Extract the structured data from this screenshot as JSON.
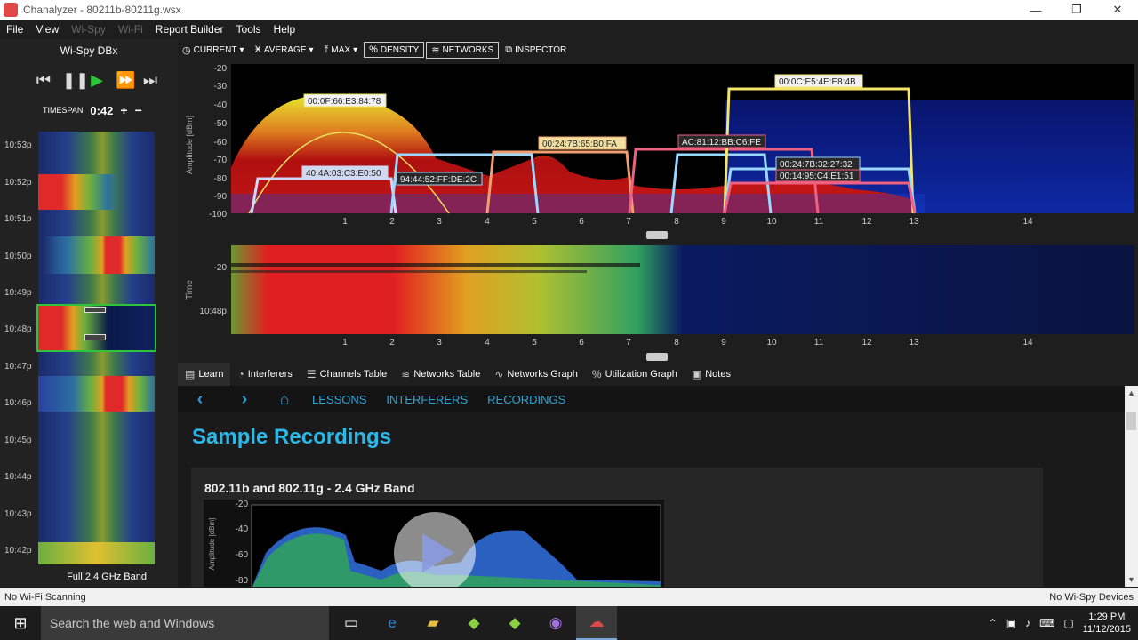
{
  "window": {
    "title": "Chanalyzer - 80211b-80211g.wsx",
    "minimize": "—",
    "restore": "❐",
    "close": "✕"
  },
  "menu": {
    "items": [
      {
        "label": "File",
        "dim": false
      },
      {
        "label": "View",
        "dim": false
      },
      {
        "label": "Wi-Spy",
        "dim": true
      },
      {
        "label": "Wi-Fi",
        "dim": true
      },
      {
        "label": "Report Builder",
        "dim": false
      },
      {
        "label": "Tools",
        "dim": false
      },
      {
        "label": "Help",
        "dim": false
      }
    ]
  },
  "left": {
    "device": "Wi-Spy DBx",
    "transport": {
      "prev": "⏮",
      "pause": "❚❚",
      "play": "▶",
      "ffwd": "⏩",
      "end": "⏭"
    },
    "timespan_label": "TIMESPAN",
    "timespan_value": "0:42",
    "plus": "+",
    "minus": "−",
    "times": [
      "10:53p",
      "10:52p",
      "10:51p",
      "10:50p",
      "10:49p",
      "10:48p",
      "10:47p",
      "10:46p",
      "10:45p",
      "10:44p",
      "10:43p",
      "10:42p"
    ],
    "band_label": "Full 2.4 GHz Band"
  },
  "toolbar": {
    "current": "CURRENT",
    "average": "AVERAGE",
    "max": "MAX",
    "density": "DENSITY",
    "networks": "NETWORKS",
    "inspector": "INSPECTOR"
  },
  "chart": {
    "ylabel": "Amplitude [dBm]",
    "yticks": [
      "-20",
      "-30",
      "-40",
      "-50",
      "-60",
      "-70",
      "-80",
      "-90",
      "-100"
    ],
    "xticks": [
      "1",
      "2",
      "3",
      "4",
      "5",
      "6",
      "7",
      "8",
      "9",
      "10",
      "11",
      "12",
      "13",
      "14"
    ],
    "networks": [
      {
        "ssid": "00:0F:66:E3:84:78",
        "color": "#e8e05a"
      },
      {
        "ssid": "00:0C:E5:4E:E8:4B",
        "color": "#f5e66a"
      },
      {
        "ssid": "00:24:7B:65:B0:FA",
        "color": "#f0a070"
      },
      {
        "ssid": "AC:81:12:BB:C6:FE",
        "color": "#f06080"
      },
      {
        "ssid": "40:4A:03:C3:E0:50",
        "color": "#cfd8ff"
      },
      {
        "ssid": "94:44:52:FF:DE:2C",
        "color": "#9ad8ff"
      },
      {
        "ssid": "00:24:7B:32:27:32",
        "color": "#9ad8ff"
      },
      {
        "ssid": "00:14:95:C4:E1:51",
        "color": "#f06080"
      }
    ]
  },
  "waterfall": {
    "ylabel": "Time",
    "ytick": "-20",
    "time": "10:48p",
    "xticks": [
      "1",
      "2",
      "3",
      "4",
      "5",
      "6",
      "7",
      "8",
      "9",
      "10",
      "11",
      "12",
      "13",
      "14"
    ]
  },
  "tabs": [
    "Learn",
    "Interferers",
    "Channels Table",
    "Networks Table",
    "Networks Graph",
    "Utilization Graph",
    "Notes"
  ],
  "learn": {
    "back": "‹",
    "forward": "›",
    "home": "⌂",
    "links": [
      "LESSONS",
      "INTERFERERS",
      "RECORDINGS"
    ],
    "title": "Sample Recordings",
    "recording_title": "802.11b and 802.11g - 2.4 GHz Band",
    "thumb_ylabel": "Amplitude [dBm]",
    "thumb_yticks": [
      "-20",
      "-40",
      "-60",
      "-80"
    ]
  },
  "status": {
    "left": "No Wi-Fi Scanning",
    "right": "No Wi-Spy Devices"
  },
  "taskbar": {
    "search": "Search the web and Windows",
    "time": "1:29 PM",
    "date": "11/12/2015"
  },
  "colors": {
    "accent": "#2bb8e8",
    "play": "#2fc43a"
  }
}
